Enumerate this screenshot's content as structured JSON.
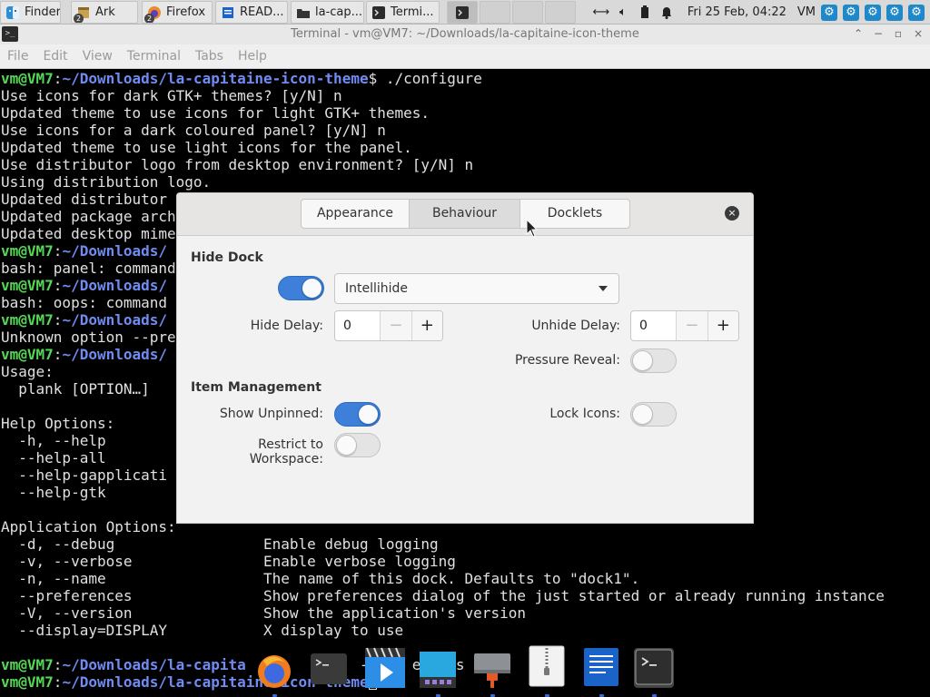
{
  "taskbar": {
    "items": [
      {
        "label": "Finder"
      },
      {
        "label": "Ark",
        "badge": "2"
      },
      {
        "label": "Firefox",
        "badge": "2"
      },
      {
        "label": "READ..."
      },
      {
        "label": "la-cap..."
      },
      {
        "label": "Termi..."
      }
    ],
    "datetime": "Fri 25 Feb, 04:22",
    "user": "VM"
  },
  "terminal": {
    "window_title": "Terminal - vm@VM7: ~/Downloads/la-capitaine-icon-theme",
    "menu": [
      "File",
      "Edit",
      "View",
      "Terminal",
      "Tabs",
      "Help"
    ],
    "prompt_user": "vm@VM7",
    "prompt_path_full": "~/Downloads/la-capitaine-icon-theme",
    "prompt_path_short": "~/Downloads/",
    "lines": [
      {
        "cmd": "$ ./configure"
      },
      {
        "text": "Use icons for dark GTK+ themes? [y/N] n"
      },
      {
        "text": "Updated theme to use icons for light GTK+ themes."
      },
      {
        "text": "Use icons for a dark coloured panel? [y/N] n"
      },
      {
        "text": "Updated theme to use light icons for the panel."
      },
      {
        "text": "Use distributor logo from desktop environment? [y/N] n"
      },
      {
        "text": "Using distribution logo."
      },
      {
        "text": "Updated distributor"
      },
      {
        "text": "Updated package arch"
      },
      {
        "text": "Updated desktop mime"
      },
      {
        "prompt_short": true
      },
      {
        "text": "bash: panel: command"
      },
      {
        "prompt_short": true
      },
      {
        "text": "bash: oops: command"
      },
      {
        "prompt_short": true
      },
      {
        "text": "Unknown option --pre"
      },
      {
        "prompt_short": true
      },
      {
        "text": "Usage:"
      },
      {
        "text": "  plank [OPTION…]"
      },
      {
        "text": ""
      },
      {
        "text": "Help Options:"
      },
      {
        "text": "  -h, --help"
      },
      {
        "text": "  --help-all"
      },
      {
        "text": "  --help-gapplicati"
      },
      {
        "text": "  --help-gtk"
      },
      {
        "text": ""
      },
      {
        "text": "Application Options:"
      },
      {
        "text": "  -d, --debug                 Enable debug logging"
      },
      {
        "text": "  -v, --verbose               Enable verbose logging"
      },
      {
        "text": "  -n, --name                  The name of this dock. Defaults to \"dock1\"."
      },
      {
        "text": "  --preferences               Show preferences dialog of the just started or already running instance"
      },
      {
        "text": "  -V, --version               Show the application's version"
      },
      {
        "text": "  --display=DISPLAY           X display to use"
      },
      {
        "text": ""
      },
      {
        "prompt_cut": "~/Downloads/la-capita",
        "tail": "        ol   --p   er   s"
      },
      {
        "prompt_cut": "~/Downloads/la-capitaine-icon-theme",
        "cursor": true
      }
    ]
  },
  "dialog": {
    "tabs": [
      "Appearance",
      "Behaviour",
      "Docklets"
    ],
    "selected_tab": "Behaviour",
    "close_glyph": "×",
    "hide_dock": {
      "section": "Hide Dock",
      "enabled": true,
      "mode": "Intellihide",
      "hide_delay_label": "Hide Delay:",
      "hide_delay": "0",
      "unhide_delay_label": "Unhide Delay:",
      "unhide_delay": "0",
      "pressure_reveal_label": "Pressure Reveal:",
      "pressure_reveal": false
    },
    "item_management": {
      "section": "Item Management",
      "show_unpinned_label": "Show Unpinned:",
      "show_unpinned": true,
      "lock_icons_label": "Lock Icons:",
      "lock_icons": false,
      "restrict_label": "Restrict to Workspace:",
      "restrict": false
    },
    "spin_minus": "−",
    "spin_plus": "+"
  },
  "dock": {
    "items": [
      "firefox-icon",
      "terminal-icon",
      "video-player-icon",
      "screen-icon",
      "network-icon",
      "archive-icon",
      "text-editor-icon",
      "terminal-active-icon"
    ]
  }
}
